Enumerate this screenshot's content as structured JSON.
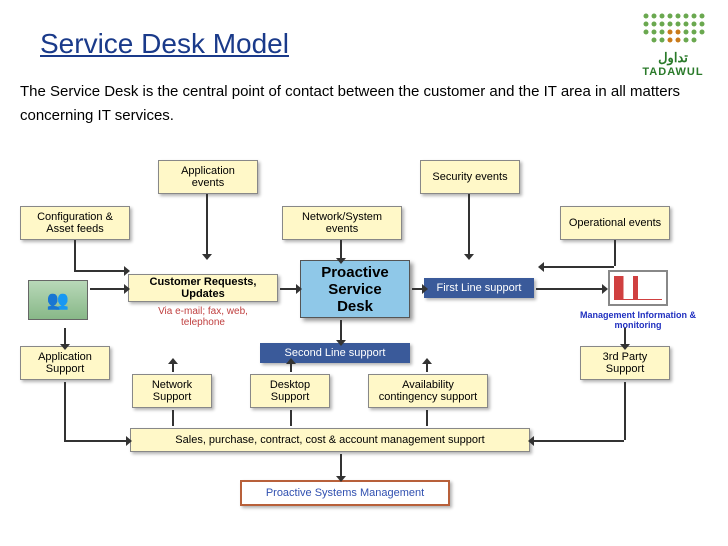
{
  "slide": {
    "title": "Service Desk Model",
    "description": "The Service Desk is the central point of contact between the customer and the IT area in all matters concerning IT services.",
    "logo": {
      "arabic": "تداول",
      "latin": "TADAWUL"
    }
  },
  "boxes": {
    "app_events": "Application events",
    "security_events": "Security events",
    "config_asset": "Configuration & Asset feeds",
    "network_system": "Network/System events",
    "operational": "Operational events",
    "customer_requests": "Customer Requests, Updates",
    "via": "Via e-mail; fax, web, telephone",
    "proactive": "Proactive Service Desk",
    "first_line": "First Line support",
    "second_line": "Second Line support",
    "app_support": "Application Support",
    "network_support": "Network Support",
    "desktop_support": "Desktop Support",
    "availability": "Availability contingency support",
    "third_party": "3rd Party Support",
    "sales": "Sales, purchase, contract, cost & account management support",
    "proactive_mgmt": "Proactive Systems Management",
    "mgmt_info": "Management Information & monitoring"
  }
}
